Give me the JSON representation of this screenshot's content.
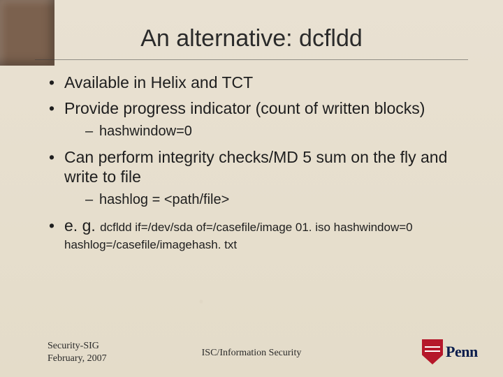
{
  "title": "An alternative: dcfldd",
  "bullets": {
    "b1": "Available in Helix and TCT",
    "b2": "Provide progress indicator (count of written blocks)",
    "b2_sub1": "hashwindow=0",
    "b3": "Can perform integrity checks/MD 5 sum on the fly and write to file",
    "b3_sub1": "hashlog = <path/file>",
    "b4_lead": "e. g. ",
    "b4_cmd": "dcfldd if=/dev/sda of=/casefile/image 01. iso hashwindow=0",
    "b4_cont": "hashlog=/casefile/imagehash. txt"
  },
  "footer": {
    "left_line1": "Security-SIG",
    "left_line2": "February, 2007",
    "center": "ISC/Information Security"
  },
  "logo": {
    "text": "Penn",
    "name": "penn-shield-logo"
  }
}
